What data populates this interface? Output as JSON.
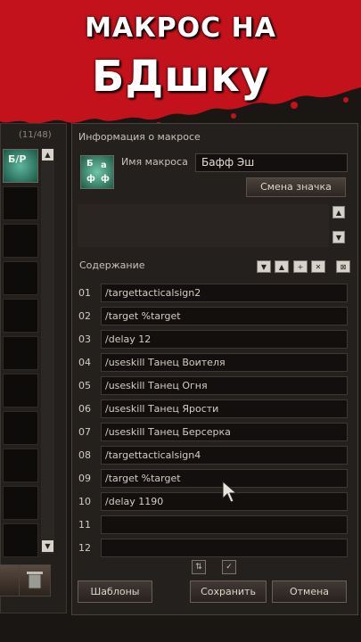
{
  "banner": {
    "line1": "МАКРОС НА",
    "line2": "БДшку"
  },
  "left_panel": {
    "count": "(11/48)",
    "icon_label": "Б/Р"
  },
  "dialog": {
    "section_info": "Информация о макросе",
    "name_label": "Имя макроса",
    "name_value": "Бафф Эш",
    "change_icon": "Смена значка",
    "icon_text": {
      "a": "Б",
      "b": "а",
      "c": "ф",
      "d": "ф"
    },
    "content_label": "Содержание",
    "rows": [
      {
        "num": "01",
        "cmd": "/targettacticalsign2"
      },
      {
        "num": "02",
        "cmd": "/target %target"
      },
      {
        "num": "03",
        "cmd": "/delay 12"
      },
      {
        "num": "04",
        "cmd": "/useskill Танец Воителя"
      },
      {
        "num": "05",
        "cmd": "/useskill Танец Огня"
      },
      {
        "num": "06",
        "cmd": "/useskill Танец Ярости"
      },
      {
        "num": "07",
        "cmd": "/useskill Танец Берсерка"
      },
      {
        "num": "08",
        "cmd": "/targettacticalsign4"
      },
      {
        "num": "09",
        "cmd": "/target %target"
      },
      {
        "num": "10",
        "cmd": "/delay 1190"
      },
      {
        "num": "11",
        "cmd": ""
      },
      {
        "num": "12",
        "cmd": ""
      }
    ],
    "buttons": {
      "templates": "Шаблоны",
      "save": "Сохранить",
      "cancel": "Отмена"
    }
  },
  "icons": [
    "scroll-up-icon",
    "scroll-down-icon",
    "move-line-down-icon",
    "move-line-up-icon",
    "add-line-icon",
    "delete-line-icon",
    "clear-all-icon",
    "import-icon",
    "confirm-icon",
    "trash-icon",
    "mouse-cursor-icon"
  ]
}
